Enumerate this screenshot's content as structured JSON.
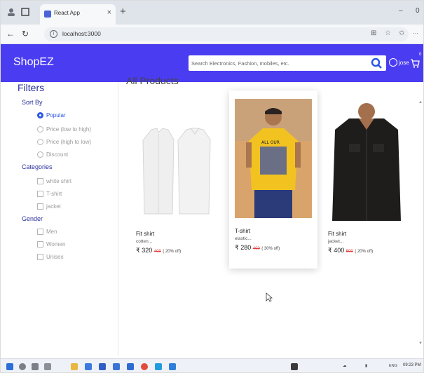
{
  "browser": {
    "tab_title": "React App",
    "tab_close": "×",
    "new_tab": "+",
    "url": "localhost:3000",
    "minimize": "–",
    "window_extra": "0",
    "more": "···"
  },
  "header": {
    "brand": "ShopEZ",
    "search_placeholder": "Search Electronics, Fashion, mobiles, etc.",
    "username": "jose",
    "cart_count": "0",
    "colors": {
      "primary": "#4a3cf0",
      "accent": "#2a57e6"
    }
  },
  "sidebar": {
    "title": "Filters",
    "sort_by": {
      "title": "Sort By",
      "options": [
        {
          "label": "Popular",
          "selected": true
        },
        {
          "label": "Price (low to high)",
          "selected": false
        },
        {
          "label": "Price (high to low)",
          "selected": false
        },
        {
          "label": "Discount",
          "selected": false
        }
      ]
    },
    "categories": {
      "title": "Categories",
      "options": [
        {
          "label": "white shirt"
        },
        {
          "label": "T-shirt"
        },
        {
          "label": "jacket"
        }
      ]
    },
    "gender": {
      "title": "Gender",
      "options": [
        {
          "label": "Men"
        },
        {
          "label": "Women"
        },
        {
          "label": "Unisex"
        }
      ]
    }
  },
  "content": {
    "title": "All Products",
    "products": [
      {
        "name": "Fit shirt",
        "desc": "cotten...",
        "price": "₹ 320",
        "mrp": "400",
        "discount": "( 20% off)"
      },
      {
        "name": "T-shirt",
        "desc": "elastic...",
        "price": "₹ 280",
        "mrp": "400",
        "discount": "( 30% off)"
      },
      {
        "name": "Fit shirt",
        "desc": "jacket...",
        "price": "₹ 400",
        "mrp": "500",
        "discount": "( 20% off)"
      }
    ]
  },
  "taskbar": {
    "time": "09:23 PM",
    "lang": "ENG"
  }
}
